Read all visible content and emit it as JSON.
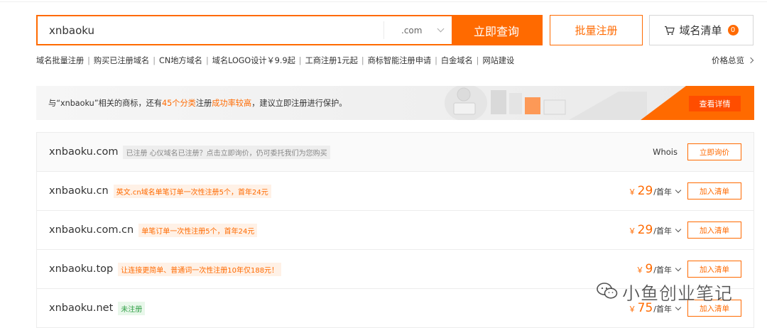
{
  "search": {
    "value": "xnbaoku",
    "suffix": ".com",
    "query_label": "立即查询"
  },
  "buttons": {
    "bulk_register": "批量注册",
    "domain_cart": "域名清单",
    "cart_count": "0"
  },
  "quick_links": [
    "域名批量注册",
    "购买已注册域名",
    "CN地方域名",
    "域名LOGO设计￥9.9起",
    "工商注册1元起",
    "商标智能注册申请",
    "白金域名",
    "网站建设"
  ],
  "price_overview": "价格总览",
  "banner": {
    "text_pre": "与“xnbaoku”相关的商标，还有",
    "highlight1": "45个分类",
    "text_mid": "注册",
    "highlight2": "成功率较高",
    "text_post": "，建议立即注册进行保护。",
    "button": "查看详情",
    "accent": "#ff6a00"
  },
  "results": [
    {
      "domain": "xnbaoku.com",
      "tag": "已注册 心仪域名已注册？点击立即询价，仍可委托我们为您购买",
      "whois": "Whois",
      "action": "立即询价"
    },
    {
      "domain": "xnbaoku.cn",
      "tag": "英文.cn域名单笔订单一次性注册5个，首年24元",
      "currency": "￥",
      "price": "29",
      "period": "/首年",
      "action": "加入清单"
    },
    {
      "domain": "xnbaoku.com.cn",
      "tag": "单笔订单一次性注册5个，首年24元",
      "currency": "￥",
      "price": "29",
      "period": "/首年",
      "action": "加入清单"
    },
    {
      "domain": "xnbaoku.top",
      "tag": "让连接更简单、普通词一次性注册10年仅188元！",
      "currency": "￥",
      "price": "9",
      "period": "/首年",
      "action": "加入清单"
    },
    {
      "domain": "xnbaoku.net",
      "tag": "未注册",
      "currency": "￥",
      "price": "75",
      "period": "/首年",
      "action": "加入清单"
    }
  ],
  "watermark": "小鱼创业笔记",
  "colors": {
    "primary": "#ff6a00",
    "text": "#333333",
    "tag_green": "#32a048"
  }
}
